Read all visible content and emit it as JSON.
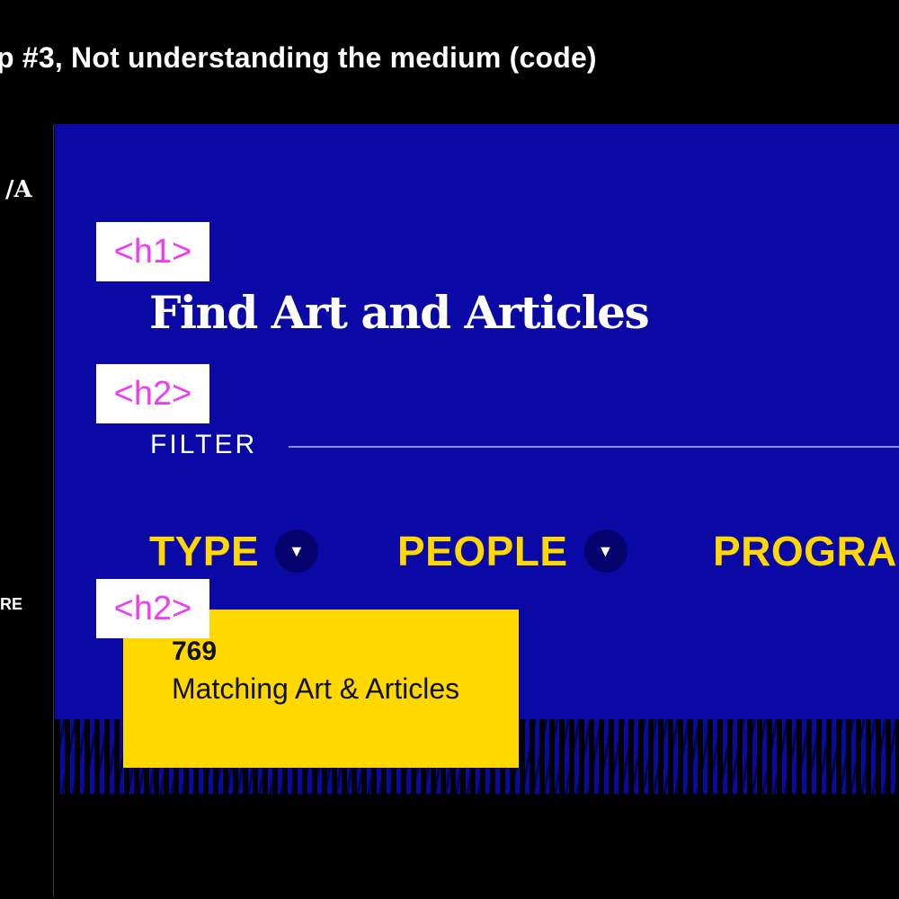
{
  "slide": {
    "title": "p #3, Not understanding the medium (code)"
  },
  "left_rail": {
    "logo": "/A",
    "nav_text": "RE"
  },
  "panel": {
    "heading": "Find Art and Articles",
    "filter_label": "FILTER",
    "filters": [
      {
        "label": "TYPE",
        "dropdown_icon": "caret-down-icon",
        "glyph": "▼"
      },
      {
        "label": "PEOPLE",
        "dropdown_icon": "caret-down-icon",
        "glyph": "▼"
      },
      {
        "label": "PROGRA",
        "dropdown_icon": "caret-down-icon",
        "glyph": ""
      }
    ],
    "results": {
      "count": "769",
      "label": "Matching Art & Articles"
    }
  },
  "annotations": {
    "h1": "<h1>",
    "h2_filter": "<h2>",
    "h2_results": "<h2>"
  },
  "colors": {
    "panel_blue": "#0a09a6",
    "accent_yellow": "#ffd800",
    "tag_magenta": "#f03cf0"
  }
}
